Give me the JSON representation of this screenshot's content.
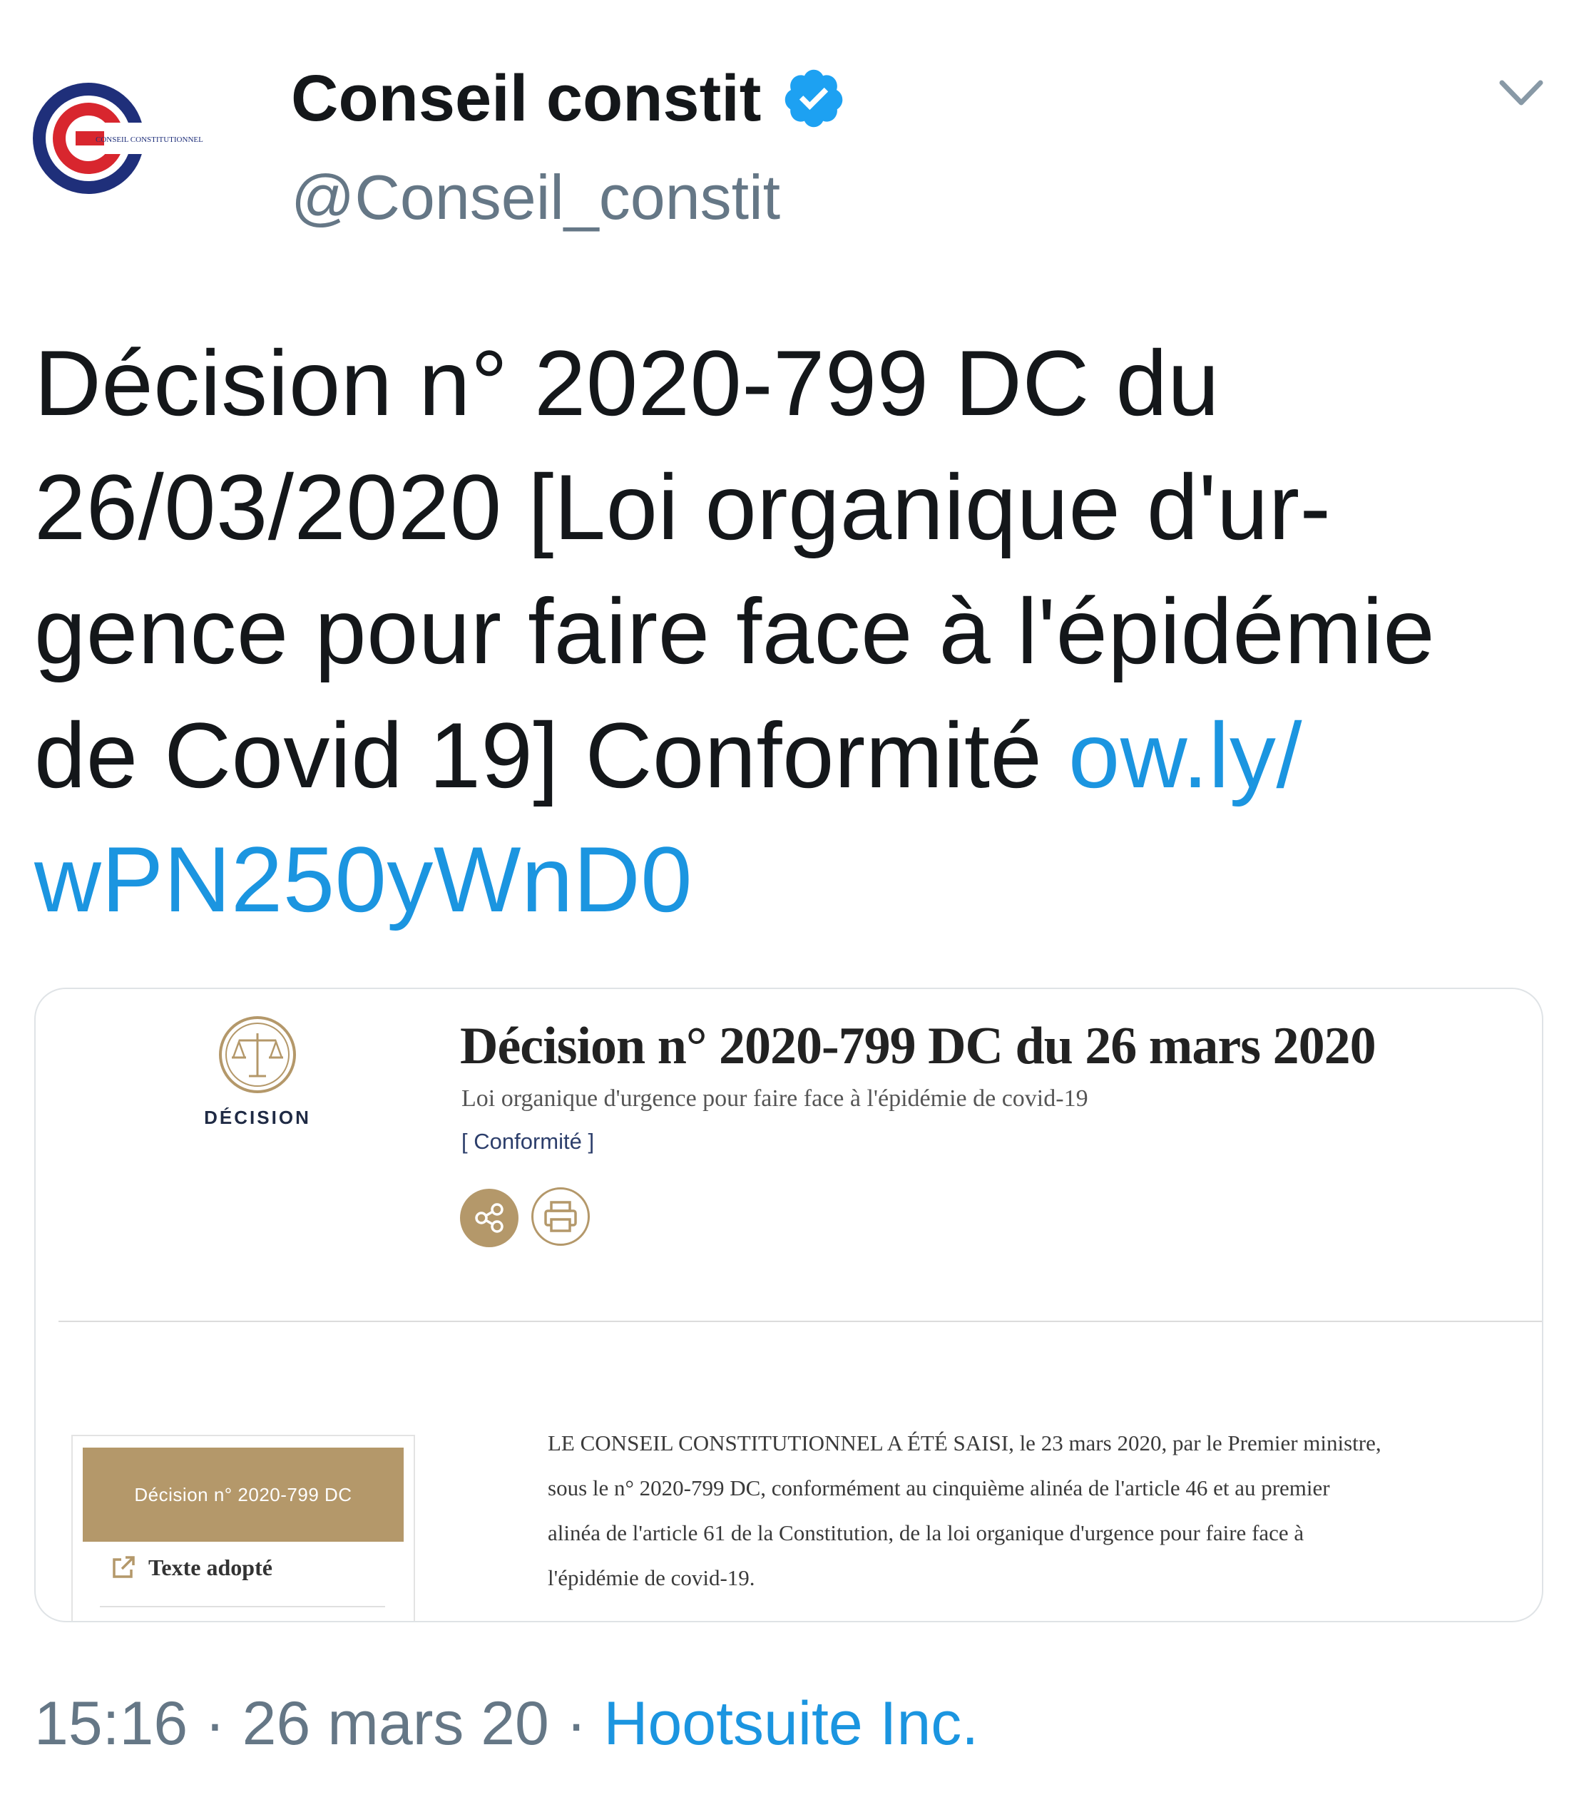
{
  "author": {
    "name": "Conseil constit",
    "handle": "@Conseil_constit",
    "verified": true,
    "avatar_icon": "conseil-constitutionnel-logo",
    "avatar_caption": "CONSEIL CONSTITUTIONNEL"
  },
  "tweet": {
    "text": "Décision n° 2020-799 DC du\n26/03/2020 [Loi organique d'ur-\ngence pour faire face à l'épidémie\nde Covid 19] Conformité ",
    "link_line1": "ow.ly/",
    "link_line2": "wPN250yWnD0"
  },
  "card": {
    "emblem_icon": "scales-of-justice-icon",
    "emblem_label": "DÉCISION",
    "title": "Décision n° 2020-799 DC du 26 mars 2020",
    "subtitle": "Loi organique d'urgence pour faire face à l'épidémie de covid-19",
    "verdict": "[ Conformité ]",
    "share_icon": "share-icon",
    "print_icon": "printer-icon",
    "side_panel": {
      "header": "Décision n° 2020-799 DC",
      "link_label": "Texte adopté",
      "link_icon": "external-link-icon"
    },
    "body": "LE CONSEIL CONSTITUTIONNEL A ÉTÉ SAISI, le 23 mars 2020, par le Premier ministre,\nsous le n° 2020-799 DC, conformément au cinquième alinéa de l'article 46 et au premier\nalinéa de l'article 61 de la Constitution, de la loi organique d'urgence pour faire face à\nl'épidémie de covid-19."
  },
  "meta": {
    "time": "15:16",
    "separator": "·",
    "date": "26 mars 20",
    "source": "Hootsuite Inc."
  },
  "colors": {
    "link": "#1b95e0",
    "secondary_text": "#657786",
    "gold": "#b4986a",
    "verified": "#1da1f2"
  }
}
